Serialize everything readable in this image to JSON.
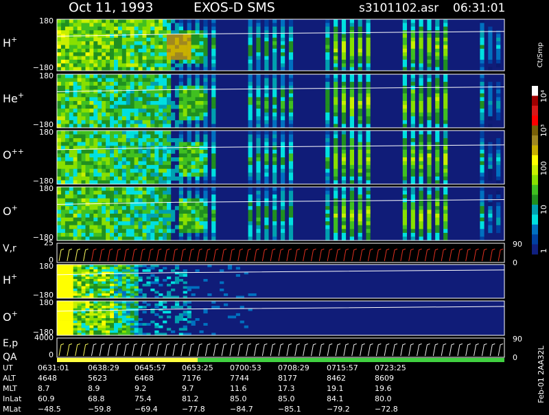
{
  "header": {
    "date": "Oct 11, 1993",
    "instrument": "EXOS-D SMS",
    "file": "s3101102.asr",
    "start_time": "06:31:01"
  },
  "colorbar": {
    "unit": "Ct/Smp",
    "tick_labels": [
      "10⁴",
      "10³",
      "100",
      "10",
      "1"
    ],
    "colors": [
      "#ffffff",
      "#a00000",
      "#d81818",
      "#ff0000",
      "#786008",
      "#a08820",
      "#c8b000",
      "#ffff00",
      "#c8f000",
      "#88e000",
      "#40c020",
      "#209020",
      "#00a0b0",
      "#00e0e0",
      "#0070c0",
      "#0040a0",
      "#102080"
    ]
  },
  "panels": {
    "h_plus": {
      "label": "H",
      "sup": "+",
      "ymax": "180",
      "ymin": "−180"
    },
    "he_plus": {
      "label": "He",
      "sup": "+",
      "ymax": "180",
      "ymin": "−180"
    },
    "o_pp": {
      "label": "O",
      "sup": "++",
      "ymax": "180",
      "ymin": "−180"
    },
    "o_plus": {
      "label": "O",
      "sup": "+",
      "ymax": "180",
      "ymin": "−180"
    },
    "vr": {
      "label": "V,r",
      "ymax": "25",
      "ymin": "0",
      "right_top": "90",
      "right_bottom": "0"
    },
    "h_plus_low": {
      "label": "H",
      "sup": "+",
      "ymax": "180",
      "ymin": "−180"
    },
    "o_plus_low": {
      "label": "O",
      "sup": "+",
      "ymax": "180",
      "ymin": "−180"
    },
    "ep": {
      "label": "E,p",
      "ymax": "4000",
      "ymin": "0",
      "right_top": "90",
      "right_bottom": "0"
    },
    "qa": {
      "label": "QA"
    }
  },
  "side_label": "Feb-01 2AA32L",
  "ephemeris": {
    "labels": [
      "UT",
      "ALT",
      "MLT",
      "InLat",
      "MLat"
    ],
    "rows": [
      [
        "0631:01",
        "0638:29",
        "0645:57",
        "0653:25",
        "0700:53",
        "0708:29",
        "0715:57",
        "0723:25"
      ],
      [
        "4648",
        "5623",
        "6468",
        "7176",
        "7744",
        "8177",
        "8462",
        "8609"
      ],
      [
        "8.7",
        "8.9",
        "9.2",
        "9.7",
        "11.6",
        "17.3",
        "19.1",
        "19.6"
      ],
      [
        "60.9",
        "68.8",
        "75.4",
        "81.2",
        "85.0",
        "85.0",
        "84.1",
        "80.0"
      ],
      [
        "−48.5",
        "−59.8",
        "−69.4",
        "−77.8",
        "−84.7",
        "−85.1",
        "−79.2",
        "−72.8"
      ]
    ]
  },
  "chart_data": {
    "type": "heatmap",
    "title": "Oct 11, 1993 EXOS-D SMS s3101102.asr 06:31:01",
    "x": [
      "0631:01",
      "0638:29",
      "0645:57",
      "0653:25",
      "0700:53",
      "0708:29",
      "0715:57",
      "0723:25"
    ],
    "colorbar_label": "Ct/Smp",
    "colorbar_ticks": [
      "1",
      "10",
      "100",
      "10³",
      "10⁴"
    ],
    "series": [
      {
        "name": "H+",
        "ylim": [
          -180,
          180
        ]
      },
      {
        "name": "He+",
        "ylim": [
          -180,
          180
        ]
      },
      {
        "name": "O++",
        "ylim": [
          -180,
          180
        ]
      },
      {
        "name": "O+",
        "ylim": [
          -180,
          180
        ]
      },
      {
        "name": "V,r",
        "ylim": [
          0,
          25
        ],
        "right_ylim": [
          0,
          90
        ]
      },
      {
        "name": "H+",
        "ylim": [
          -180,
          180
        ]
      },
      {
        "name": "O+",
        "ylim": [
          -180,
          180
        ]
      },
      {
        "name": "E,p",
        "ylim": [
          0,
          4000
        ],
        "right_ylim": [
          0,
          90
        ]
      },
      {
        "name": "QA"
      }
    ]
  }
}
